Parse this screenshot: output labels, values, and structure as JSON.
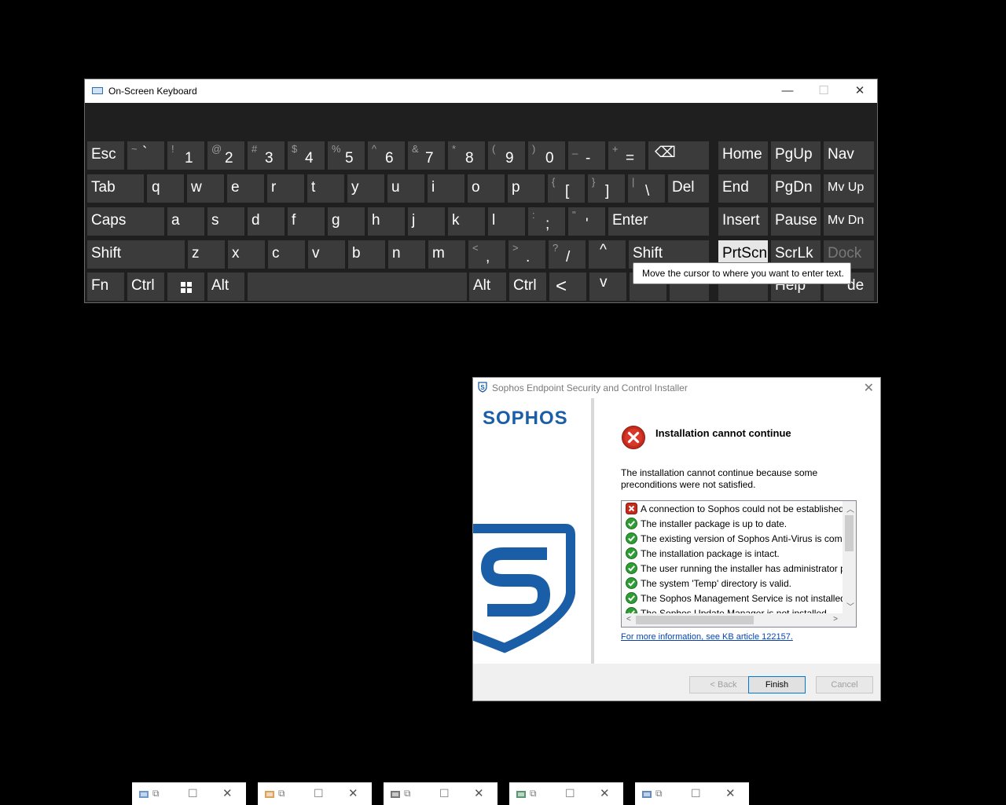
{
  "osk": {
    "title": "On-Screen Keyboard",
    "controls": {
      "minimize": "—",
      "maximize": "☐",
      "close": "✕"
    },
    "keys": {
      "esc": "Esc",
      "tilde_up": "~",
      "tilde_lo": "`",
      "n1_up": "!",
      "n1": "1",
      "n2_up": "@",
      "n2": "2",
      "n3_up": "#",
      "n3": "3",
      "n4_up": "$",
      "n4": "4",
      "n5_up": "%",
      "n5": "5",
      "n6_up": "^",
      "n6": "6",
      "n7_up": "&",
      "n7": "7",
      "n8_up": "*",
      "n8": "8",
      "n9_up": "(",
      "n9": "9",
      "n0_up": ")",
      "n0": "0",
      "minus_up": "_",
      "minus": "-",
      "eq_up": "+",
      "eq": "=",
      "backspace": "⌫",
      "home": "Home",
      "pgup": "PgUp",
      "nav": "Nav",
      "tab": "Tab",
      "q": "q",
      "w": "w",
      "e": "e",
      "r": "r",
      "t": "t",
      "y": "y",
      "u": "u",
      "i": "i",
      "o": "o",
      "p": "p",
      "lbr_up": "{",
      "lbr": "[",
      "rbr_up": "}",
      "rbr": "]",
      "bsl_up": "|",
      "bsl": "\\",
      "del": "Del",
      "end": "End",
      "pgdn": "PgDn",
      "mvup": "Mv Up",
      "caps": "Caps",
      "a": "a",
      "s": "s",
      "d": "d",
      "f": "f",
      "g": "g",
      "h": "h",
      "j": "j",
      "k": "k",
      "l": "l",
      "semi_up": ":",
      "semi": ";",
      "quote_up": "\"",
      "quote": "'",
      "enter": "Enter",
      "insert": "Insert",
      "pause": "Pause",
      "mvdn": "Mv Dn",
      "shift": "Shift",
      "z": "z",
      "x": "x",
      "c": "c",
      "v": "v",
      "b": "b",
      "n": "n",
      "m": "m",
      "comma_up": "<",
      "comma": ",",
      "dot_up": ">",
      "dot": ".",
      "slash_up": "?",
      "slash": "/",
      "arrow_up": "^",
      "shift_r": "Shift",
      "prtscn": "PrtScn",
      "scrlk": "ScrLk",
      "dock": "Dock",
      "fn": "Fn",
      "ctrl": "Ctrl",
      "alt": "Alt",
      "alt_r": "Alt",
      "ctrl_r": "Ctrl",
      "arrow_left": "<",
      "arrow_down": "v",
      "help_partial": "Help",
      "fade_partial": "de"
    },
    "tooltip": "Move the cursor to where you want to enter text."
  },
  "sophos": {
    "title": "Sophos Endpoint Security and Control Installer",
    "brand": "SOPHOS",
    "headline": "Installation cannot continue",
    "description": "The installation cannot continue because some preconditions were not satisfied.",
    "checks": [
      {
        "status": "error",
        "text": "A connection to Sophos could not be established."
      },
      {
        "status": "ok",
        "text": "The installer package is up to date."
      },
      {
        "status": "ok",
        "text": "The existing version of Sophos Anti-Virus is compatible."
      },
      {
        "status": "ok",
        "text": "The installation package is intact."
      },
      {
        "status": "ok",
        "text": "The user running the installer has administrator privileges."
      },
      {
        "status": "ok",
        "text": "The system 'Temp' directory is valid."
      },
      {
        "status": "ok",
        "text": "The Sophos Management Service is not installed."
      },
      {
        "status": "ok",
        "text": "The Sophos Update Manager is not installed."
      }
    ],
    "link": "For more information, see KB article 122157.",
    "buttons": {
      "back": "< Back",
      "finish": "Finish",
      "cancel": "Cancel"
    }
  },
  "minimized": {
    "controls": {
      "restore": "⧉",
      "maximize": "☐",
      "close": "✕"
    },
    "windows": [
      {
        "icon": "computer-management-icon"
      },
      {
        "icon": "control-panel-icon"
      },
      {
        "icon": "drive-icon"
      },
      {
        "icon": "network-icon"
      },
      {
        "icon": "system-info-icon"
      }
    ]
  }
}
